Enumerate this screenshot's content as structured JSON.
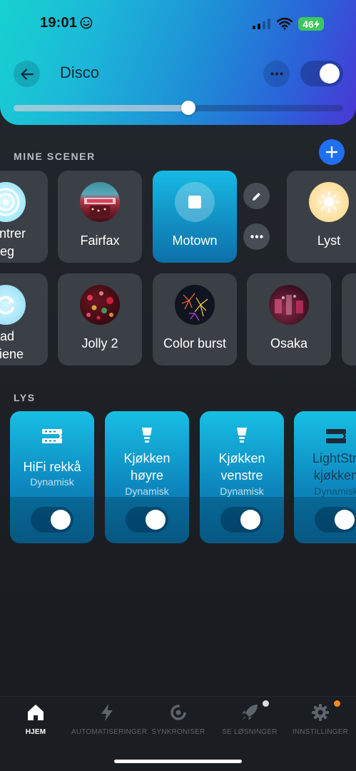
{
  "status": {
    "time": "19:01",
    "battery": "46"
  },
  "header": {
    "title": "Disco",
    "brightness": 0.53
  },
  "scenes_section": {
    "label": "MINE SCENER"
  },
  "scenes_row1": [
    {
      "label": "sentrer",
      "label2": "leg"
    },
    {
      "label": "Fairfax"
    },
    {
      "label": "Motown"
    },
    {
      "label": "Lyst"
    }
  ],
  "scenes_row2": [
    {
      "label": "lad",
      "label2": "eriene"
    },
    {
      "label": "Jolly 2"
    },
    {
      "label": "Color burst"
    },
    {
      "label": "Osaka"
    }
  ],
  "lights_section": {
    "label": "LYS"
  },
  "lights": [
    {
      "name": "HiFi rekkå",
      "name2": "",
      "state": "Dynamisk",
      "icon": "lightstrip-icon"
    },
    {
      "name": "Kjøkken",
      "name2": "høyre",
      "state": "Dynamisk",
      "icon": "bulb-icon"
    },
    {
      "name": "Kjøkken",
      "name2": "venstre",
      "state": "Dynamisk",
      "icon": "bulb-icon"
    },
    {
      "name": "LightStri",
      "name2": "kjøkken",
      "state": "Dynamisk",
      "icon": "lightstrip-icon"
    }
  ],
  "tabs": [
    {
      "label": "HJEM",
      "icon": "home-icon"
    },
    {
      "label": "AUTOMATISERINGER",
      "icon": "lightning-icon"
    },
    {
      "label": "SYNKRONISER",
      "icon": "sync-icon"
    },
    {
      "label": "SE LØSNINGER",
      "icon": "rocket-icon"
    },
    {
      "label": "INNSTILLINGER",
      "icon": "gear-icon"
    }
  ],
  "colors": {
    "accent": "#1f6ff0",
    "active_scene": "#17b9e4",
    "settings_dot": "#ff8a1c"
  }
}
